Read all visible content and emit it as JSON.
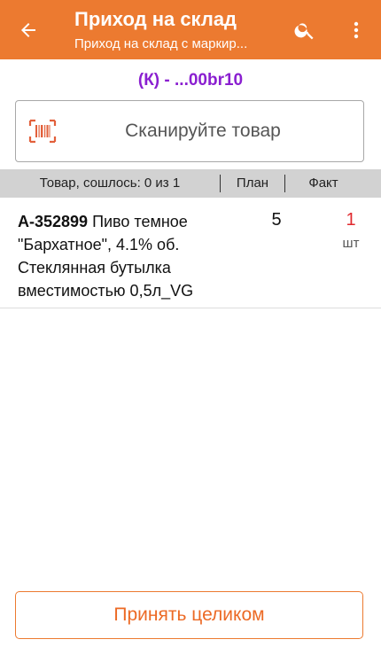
{
  "header": {
    "title": "Приход на склад",
    "subtitle": "Приход на склад с маркир..."
  },
  "document": {
    "code": "(К) - ...00br10"
  },
  "scan": {
    "placeholder": "Сканируйте товар"
  },
  "table": {
    "columns": [
      "Товар, сошлось: 0 из 1",
      "План",
      "Факт"
    ],
    "rows": [
      {
        "article": "А-352899",
        "name": " Пиво темное \"Бархатное\", 4.1% об. Стеклянная бутылка вместимостью 0,5л_VG",
        "plan": "5",
        "fact": "1",
        "unit": "шт"
      }
    ]
  },
  "footer": {
    "accept_label": "Принять целиком"
  },
  "colors": {
    "accent": "#ec7a30",
    "doc_code": "#8a1fd0",
    "fact": "#e0292e"
  },
  "icons": {
    "back": "arrow-left-icon",
    "search": "search-icon",
    "more": "more-vert-icon",
    "barcode": "barcode-icon"
  }
}
